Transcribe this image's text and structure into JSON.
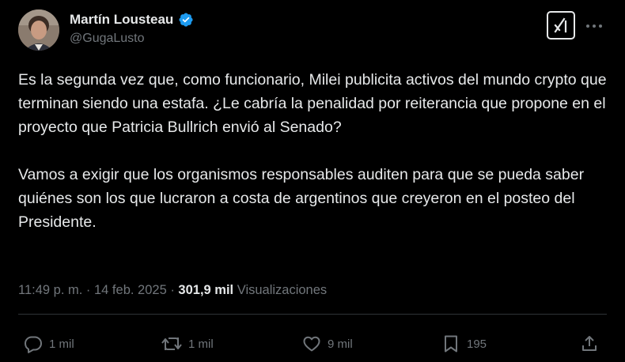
{
  "author": {
    "display_name": "Martín Lousteau",
    "handle": "@GugaLusto",
    "verified_color": "#1d9bf0"
  },
  "tweet": {
    "paragraphs": [
      "Es la segunda vez que, como funcionario, Milei publicita activos del mundo crypto que terminan siendo una estafa. ¿Le cabría la penalidad por reiterancia que propone en el proyecto que Patricia Bullrich envió al Senado?",
      "Vamos a exigir que los organismos responsables auditen para que se pueda saber quiénes son los que lucraron a costa de argentinos que creyeron en el posteo del Presidente."
    ]
  },
  "meta": {
    "time": "11:49 p. m.",
    "separator": " · ",
    "date": "14 feb. 2025",
    "views_count": "301,9 mil",
    "views_label": "Visualizaciones"
  },
  "actions": {
    "replies": "1 mil",
    "reposts": "1 mil",
    "likes": "9 mil",
    "bookmarks": "195"
  },
  "icons": {
    "verified": "verified-badge-icon",
    "grok": "grok-icon",
    "more": "more-icon",
    "reply": "reply-icon",
    "repost": "repost-icon",
    "like": "like-icon",
    "bookmark": "bookmark-icon",
    "share": "share-icon"
  }
}
